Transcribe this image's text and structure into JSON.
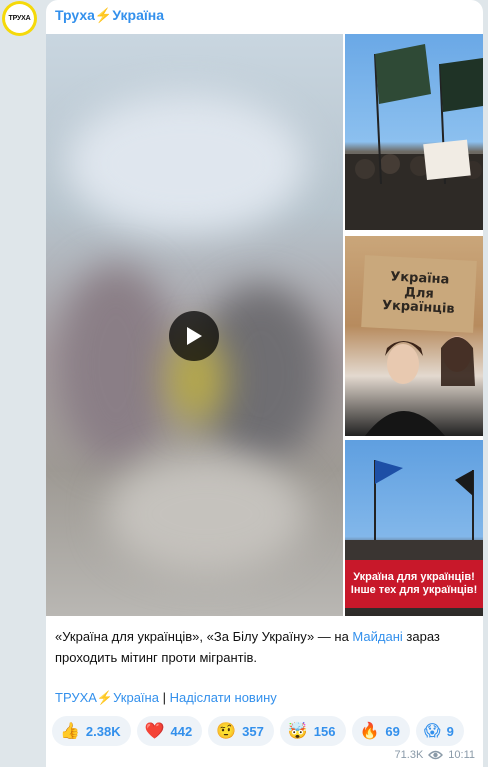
{
  "avatar": {
    "text": "ТРУХА"
  },
  "channel": {
    "name": "Труха⚡Україна"
  },
  "media": {
    "play_icon": "play-icon",
    "thumb2_sign": [
      "Україна",
      "Для",
      "Українців"
    ],
    "thumb3_banner": [
      "Україна для українців!",
      "Інше тех для українців!"
    ]
  },
  "caption": {
    "text_before": "«Україна для українців», «За Білу Україну» — на ",
    "link": "Майдані",
    "text_after": " зараз проходить мітинг проти мігрантів."
  },
  "links": {
    "channel": "ТРУХА⚡Україна",
    "separator": " | ",
    "send_news": "Надіслати новину"
  },
  "reactions": [
    {
      "emoji": "👍",
      "count": "2.38K"
    },
    {
      "emoji": "❤️",
      "count": "442"
    },
    {
      "emoji": "🤨",
      "count": "357"
    },
    {
      "emoji": "🤯",
      "count": "156"
    },
    {
      "emoji": "🔥",
      "count": "69"
    },
    {
      "emoji": "😱",
      "count": "9"
    }
  ],
  "meta": {
    "views": "71.3K",
    "views_icon": "eye-icon",
    "time": "10:11"
  }
}
